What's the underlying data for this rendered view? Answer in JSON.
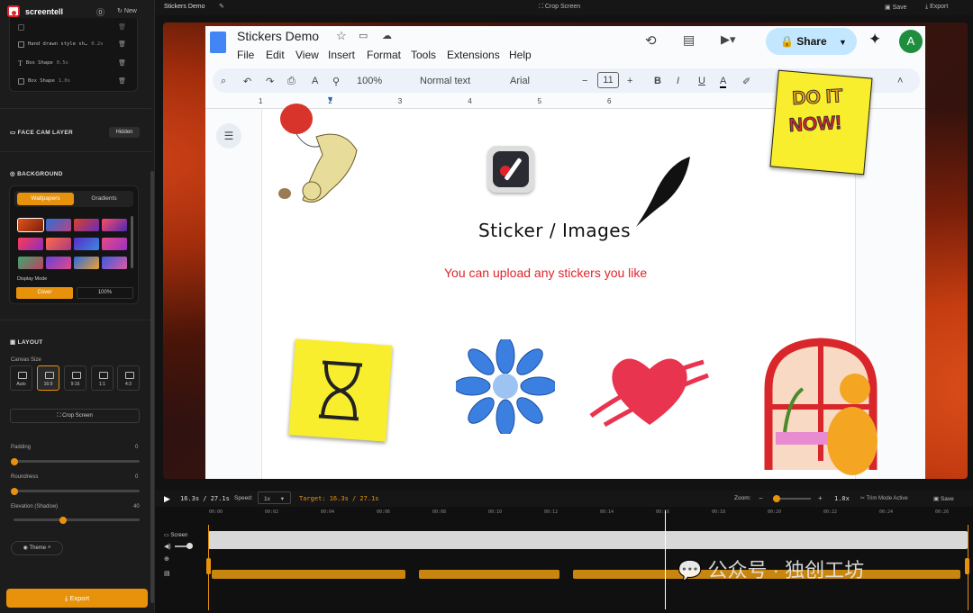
{
  "app": {
    "name": "screentell",
    "new_label": "New",
    "doc_title": "Stickers Demo",
    "crop_label": "Crop Screen",
    "save_label": "Save",
    "export_label": "Export"
  },
  "layers": [
    {
      "name": "Hand drawn style sh…",
      "time": "0.2s",
      "icon": "checkbox-icon"
    },
    {
      "name": "Box Shape",
      "time": "0.5s",
      "icon": "text-icon"
    },
    {
      "name": "Box Shape",
      "time": "1.0s",
      "icon": "checkbox-icon"
    }
  ],
  "face_cam": {
    "title": "FACE CAM LAYER",
    "status": "Hidden"
  },
  "background": {
    "title": "BACKGROUND",
    "tabs": [
      "Wallpapers",
      "Gradients"
    ],
    "active_tab": "Wallpapers",
    "display_mode_label": "Display Mode",
    "mode": "Cover",
    "scale": "100%"
  },
  "layout": {
    "title": "LAYOUT",
    "canvas_size_label": "Canvas Size",
    "sizes": [
      "Auto",
      "16:9",
      "9:16",
      "1:1",
      "4:3"
    ],
    "selected": "16:9",
    "crop_button": "Crop Screen",
    "padding": {
      "label": "Padding",
      "value": "0"
    },
    "roundness": {
      "label": "Roundness",
      "value": "0"
    },
    "elevation": {
      "label": "Elevation (Shadow)",
      "value": "40"
    }
  },
  "theme_label": "Theme",
  "export_button": "Export",
  "gdoc": {
    "title": "Stickers Demo",
    "menus": [
      "File",
      "Edit",
      "View",
      "Insert",
      "Format",
      "Tools",
      "Extensions",
      "Help"
    ],
    "share": "Share",
    "avatar": "A",
    "zoom": "100%",
    "style": "Normal text",
    "font": "Arial",
    "size": "11",
    "ruler": [
      "1",
      "2",
      "3",
      "4",
      "5",
      "6"
    ],
    "heading": "Sticker / Images",
    "subtext": "You can upload any stickers you like",
    "note_line1": "DO IT",
    "note_line2": "NOW!"
  },
  "playback": {
    "time": "16.3s / 27.1s",
    "speed_label": "Speed:",
    "speed": "1x",
    "target": "Target: 16.3s / 27.1s",
    "zoom_label": "Zoom:",
    "zoom_value": "1.0x",
    "trim": "Trim Mode Active",
    "save": "Save"
  },
  "timeline": {
    "ticks": [
      "00:00",
      "00:02",
      "00:04",
      "00:06",
      "00:08",
      "00:10",
      "00:12",
      "00:14",
      "00:16",
      "00:18",
      "00:20",
      "00:22",
      "00:24",
      "00:26"
    ],
    "screen_label": "Screen",
    "playhead_fraction": 0.602
  },
  "watermark": "公众号 · 独创工坊",
  "colors": {
    "accent": "#e8920c",
    "doc_red": "#e0242b",
    "link_blue": "#1a73e8"
  }
}
